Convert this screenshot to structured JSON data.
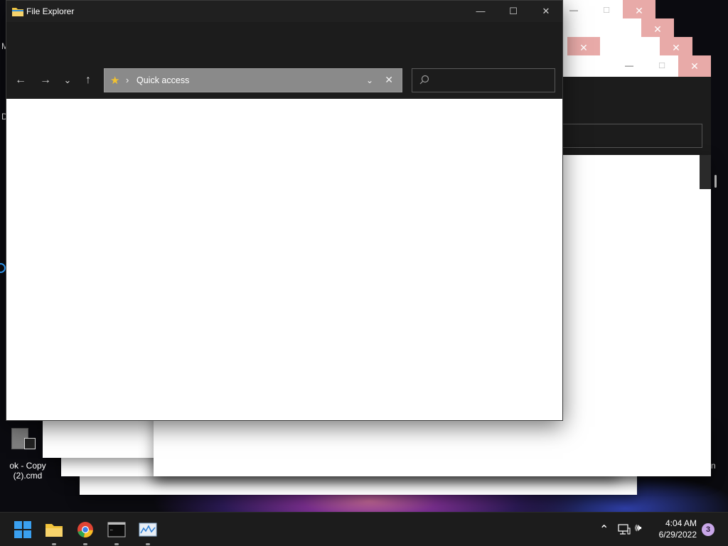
{
  "window": {
    "title": "File Explorer",
    "minimize_glyph": "—",
    "maximize_glyph": "☐",
    "close_glyph": "✕"
  },
  "nav": {
    "back_glyph": "←",
    "forward_glyph": "→",
    "recent_glyph": "⌄",
    "up_glyph": "↑"
  },
  "address": {
    "separator": "›",
    "path": "Quick access",
    "dropdown_glyph": "⌄",
    "clear_glyph": "✕"
  },
  "search": {
    "placeholder": ""
  },
  "ghost_windows": {
    "close_glyph": "✕",
    "maximize_glyph": "☐",
    "minimize_glyph": "—"
  },
  "desktop": {
    "icons": [
      {
        "label_line1": "ok - Copy",
        "label_line2": "(2).cmd"
      }
    ],
    "edge_letters": [
      "M",
      "D"
    ],
    "edge_right_letter": "n"
  },
  "taskbar": {
    "apps": [
      {
        "name": "start",
        "icon": "windows-logo-icon"
      },
      {
        "name": "file-explorer",
        "icon": "folder-icon"
      },
      {
        "name": "chrome",
        "icon": "chrome-icon"
      },
      {
        "name": "terminal",
        "icon": "terminal-icon"
      },
      {
        "name": "resource-monitor",
        "icon": "monitor-chart-icon"
      }
    ],
    "tray": {
      "chevron_glyph": "⌃",
      "speaker_glyph": "🕪",
      "time": "4:04 AM",
      "date": "6/29/2022",
      "notification_count": "3"
    }
  },
  "colors": {
    "accent_close": "#e8aaa8",
    "badge": "#c9a7e8",
    "address_bar": "#8a8a8a"
  }
}
